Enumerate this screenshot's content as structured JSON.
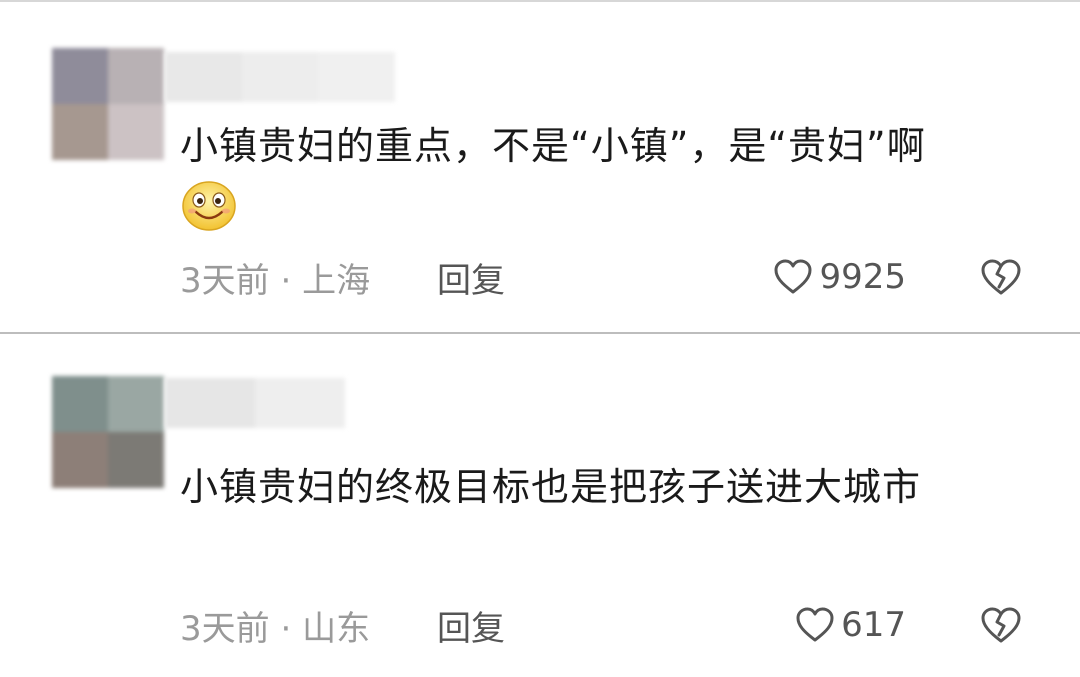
{
  "comments": [
    {
      "text": "小镇贵妇的重点，不是“小镇”，是“贵妇”啊",
      "emoji": "smiling-face-emoji",
      "time": "3天前",
      "separator": "·",
      "location": "上海",
      "reply_label": "回复",
      "likes": "9925",
      "avatar_colors": [
        "#8f8c9a",
        "#b8b1b4",
        "#a69890",
        "#ccc2c4"
      ],
      "username_colors": [
        "#e8e8e8",
        "#ededed",
        "#f0f0f0"
      ]
    },
    {
      "text": "小镇贵妇的终极目标也是把孩子送进大城市",
      "emoji": null,
      "time": "3天前",
      "separator": "·",
      "location": "山东",
      "reply_label": "回复",
      "likes": "617",
      "avatar_colors": [
        "#7f8f8c",
        "#9aa7a3",
        "#8d7f78",
        "#7c7a75"
      ],
      "username_colors": [
        "#e6e6e6",
        "#eeeeee"
      ]
    }
  ],
  "icons": {
    "like": "heart-outline-icon",
    "dislike": "broken-heart-icon"
  },
  "colors": {
    "text": "#1a1a1a",
    "meta": "#9a9a9a",
    "action": "#555555",
    "divider": "#bdbdbd"
  }
}
